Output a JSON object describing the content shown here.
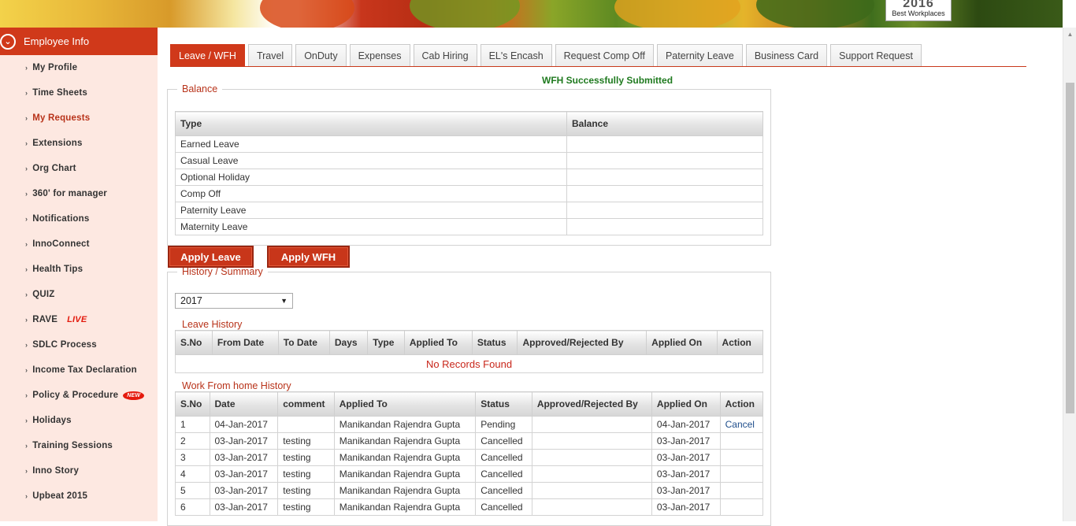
{
  "banner": {
    "badge_year": "2016",
    "badge_text": "Best Workplaces"
  },
  "sidebar": {
    "header": "Employee Info",
    "items": [
      {
        "label": "My Profile"
      },
      {
        "label": "Time Sheets"
      },
      {
        "label": "My Requests",
        "active": true
      },
      {
        "label": "Extensions"
      },
      {
        "label": "Org Chart"
      },
      {
        "label": "360' for manager"
      },
      {
        "label": "Notifications"
      },
      {
        "label": "InnoConnect"
      },
      {
        "label": "Health Tips"
      },
      {
        "label": "QUIZ"
      },
      {
        "label": "RAVE",
        "tag": "LIVE"
      },
      {
        "label": "SDLC Process"
      },
      {
        "label": "Income Tax Declaration"
      },
      {
        "label": "Policy & Procedure",
        "tag": "NEW"
      },
      {
        "label": "Holidays"
      },
      {
        "label": "Training Sessions"
      },
      {
        "label": "Inno Story"
      },
      {
        "label": "Upbeat 2015"
      }
    ]
  },
  "tabs": [
    "Leave / WFH",
    "Travel",
    "OnDuty",
    "Expenses",
    "Cab Hiring",
    "EL's Encash",
    "Request Comp Off",
    "Paternity Leave",
    "Business Card",
    "Support Request"
  ],
  "message": "WFH Successfully Submitted",
  "balance": {
    "legend": "Balance",
    "headers": [
      "Type",
      "Balance"
    ],
    "rows": [
      [
        "Earned Leave",
        ""
      ],
      [
        "Casual Leave",
        ""
      ],
      [
        "Optional Holiday",
        ""
      ],
      [
        "Comp Off",
        ""
      ],
      [
        "Paternity Leave",
        ""
      ],
      [
        "Maternity Leave",
        ""
      ]
    ]
  },
  "buttons": {
    "apply_leave": "Apply Leave",
    "apply_wfh": "Apply WFH"
  },
  "history": {
    "legend": "History / Summary",
    "year": "2017",
    "leave_title": "Leave History",
    "leave_headers": [
      "S.No",
      "From Date",
      "To Date",
      "Days",
      "Type",
      "Applied To",
      "Status",
      "Approved/Rejected By",
      "Applied On",
      "Action"
    ],
    "leave_empty": "No Records Found",
    "wfh_title": "Work From home History",
    "wfh_headers": [
      "S.No",
      "Date",
      "comment",
      "Applied To",
      "Status",
      "Approved/Rejected By",
      "Applied On",
      "Action"
    ],
    "wfh_rows": [
      [
        "1",
        "04-Jan-2017",
        "",
        "Manikandan Rajendra Gupta",
        "Pending",
        "",
        "04-Jan-2017",
        "Cancel"
      ],
      [
        "2",
        "03-Jan-2017",
        "testing",
        "Manikandan Rajendra Gupta",
        "Cancelled",
        "",
        "03-Jan-2017",
        ""
      ],
      [
        "3",
        "03-Jan-2017",
        "testing",
        "Manikandan Rajendra Gupta",
        "Cancelled",
        "",
        "03-Jan-2017",
        ""
      ],
      [
        "4",
        "03-Jan-2017",
        "testing",
        "Manikandan Rajendra Gupta",
        "Cancelled",
        "",
        "03-Jan-2017",
        ""
      ],
      [
        "5",
        "03-Jan-2017",
        "testing",
        "Manikandan Rajendra Gupta",
        "Cancelled",
        "",
        "03-Jan-2017",
        ""
      ],
      [
        "6",
        "03-Jan-2017",
        "testing",
        "Manikandan Rajendra Gupta",
        "Cancelled",
        "",
        "03-Jan-2017",
        ""
      ]
    ]
  }
}
